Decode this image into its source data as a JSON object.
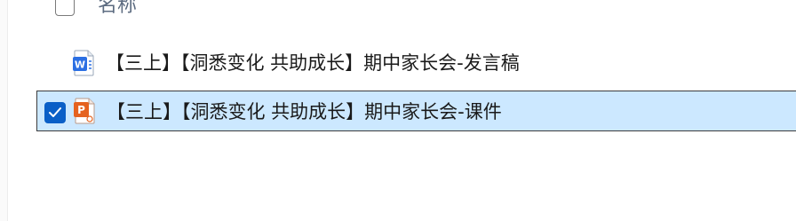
{
  "header": {
    "name_column_label": "名称"
  },
  "files": [
    {
      "name": "【三上】【洞悉变化  共助成长】期中家长会-发言稿",
      "type": "word-document",
      "icon_letter": "W",
      "selected": false
    },
    {
      "name": "【三上】【洞悉变化  共助成长】期中家长会-课件",
      "type": "powerpoint-presentation",
      "icon_letter": "P",
      "selected": true
    }
  ],
  "colors": {
    "selection_background": "#cce8ff",
    "checkbox_checked": "#0a5fc7",
    "word_blue": "#2b6fe3",
    "powerpoint_orange": "#e5621f",
    "header_text": "#5c6b80"
  }
}
